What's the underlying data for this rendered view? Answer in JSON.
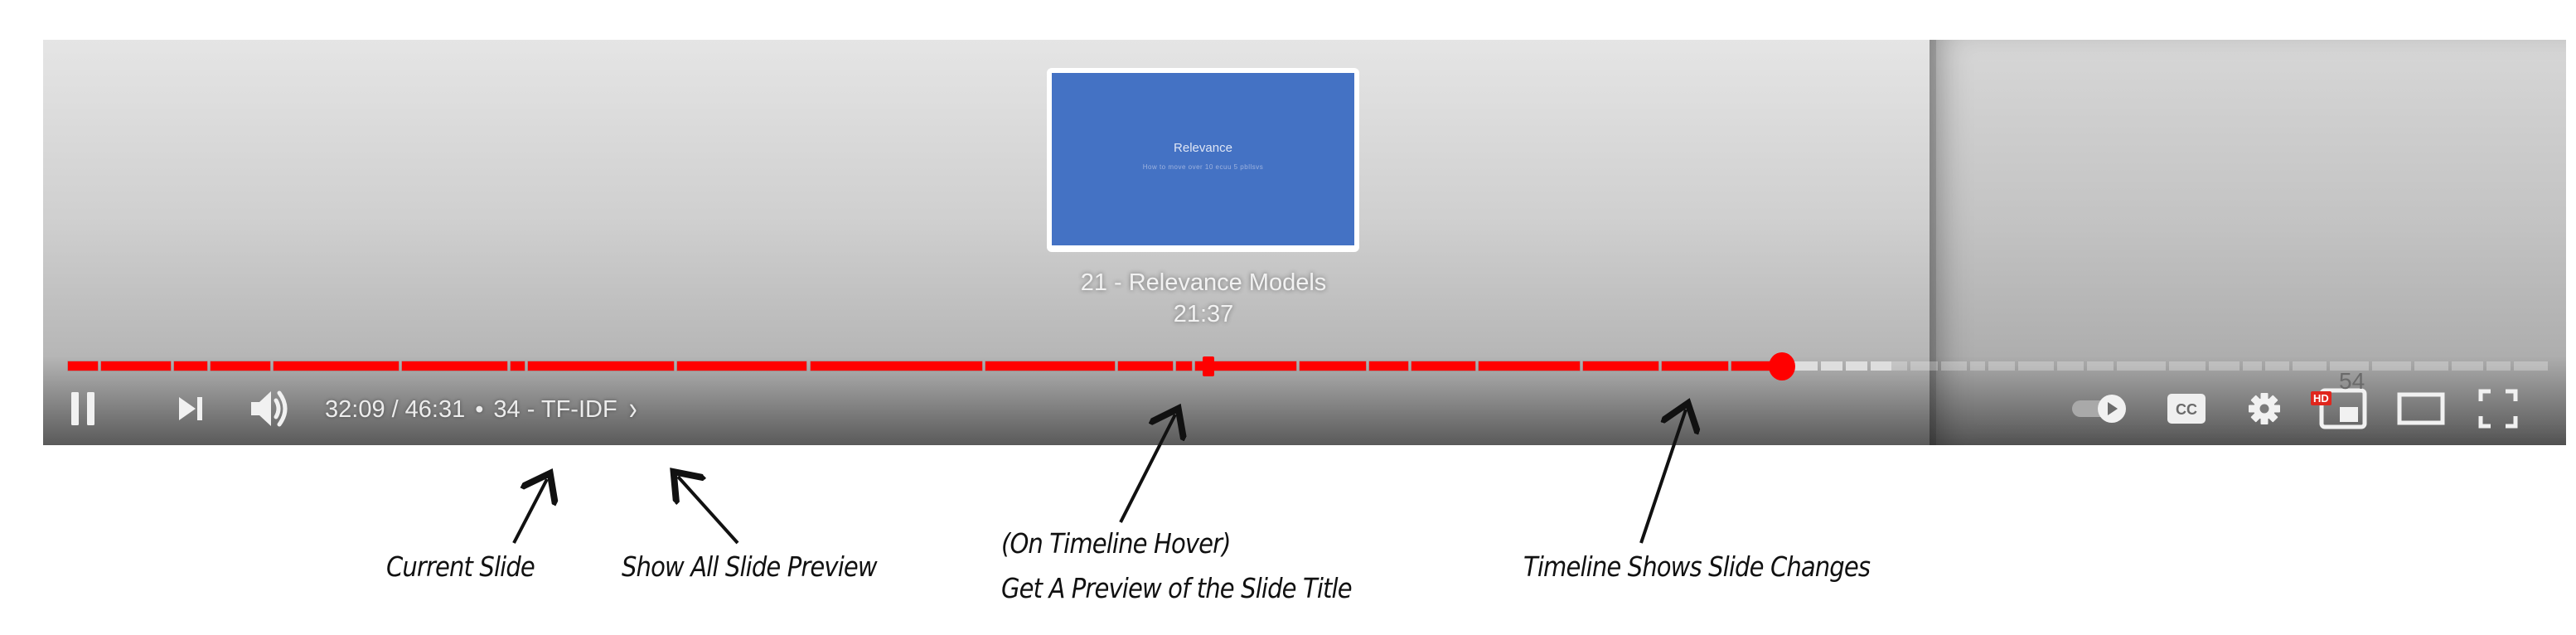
{
  "player": {
    "preview": {
      "slide_title": "Relevance",
      "slide_subtitle": "How to move over 10 ecuu 5 pbllsvs",
      "caption_title": "21 - Relevance Models",
      "caption_time": "21:37"
    },
    "timeline": {
      "current_time": "32:09",
      "total_time": "46:31",
      "progress_fraction": 0.691,
      "buffered_fraction": 0.735,
      "hover_fraction": 0.46,
      "played_color": "#ff0000",
      "chapter_boundaries_fraction": [
        0,
        0.0133,
        0.0427,
        0.0573,
        0.0827,
        0.1344,
        0.1784,
        0.1851,
        0.2454,
        0.2989,
        0.3695,
        0.4228,
        0.4464,
        0.454,
        0.496,
        0.524,
        0.541,
        0.568,
        0.61,
        0.642,
        0.67,
        0.687,
        0.691,
        0.706,
        0.716,
        0.726,
        0.742,
        0.7545,
        0.766,
        0.7733,
        0.7855,
        0.801,
        0.813,
        0.825,
        0.846,
        0.862,
        0.876,
        0.885,
        0.896,
        0.911,
        0.928,
        0.945,
        0.96,
        0.974,
        0.985,
        1.0
      ]
    },
    "controls": {
      "time_separator": "/",
      "bullet": "•",
      "chapter_label": "34 - TF-IDF",
      "chapter_chevron": "›",
      "pause_icon": "pause-icon",
      "next_icon": "next-icon",
      "volume_icon": "volume-icon",
      "autoplay_icon": "autoplay-toggle-icon",
      "cc_label": "CC",
      "settings_badge": "HD",
      "overlay_number": "54"
    }
  },
  "annotations": {
    "current_slide": "Current Slide",
    "show_all": "Show All Slide Preview",
    "hover_line1": "(On Timeline Hover)",
    "hover_line2": "Get A Preview of the Slide Title",
    "timeline_changes": "Timeline Shows Slide Changes"
  }
}
